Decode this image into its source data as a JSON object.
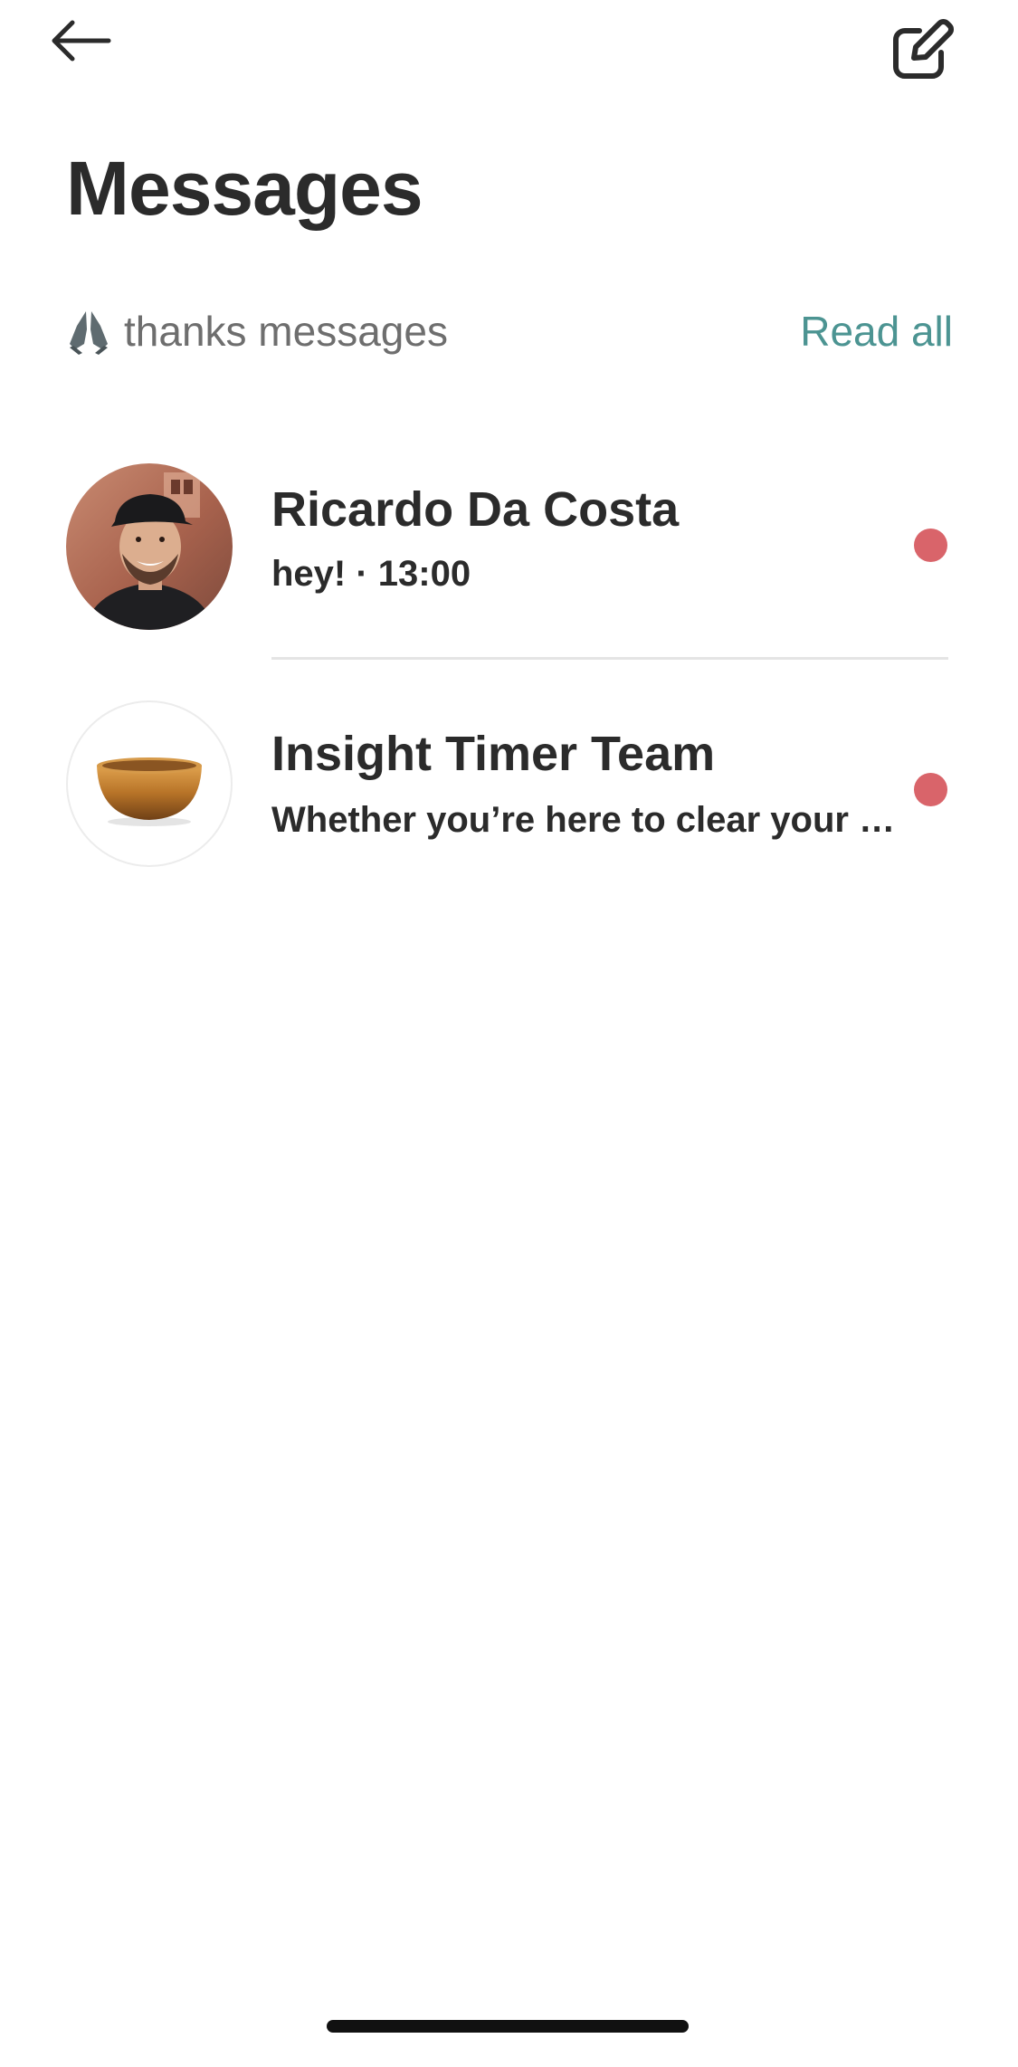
{
  "header": {
    "title": "Messages"
  },
  "filter": {
    "label": "thanks messages",
    "read_all_label": "Read all"
  },
  "conversations": [
    {
      "name": "Ricardo Da Costa",
      "preview": "hey! · 13:00",
      "unread": true
    },
    {
      "name": "Insight Timer Team",
      "preview": "Whether you’re here to clear your mi...",
      "unread": true
    }
  ],
  "icons": {
    "back": "arrow-left-icon",
    "compose": "compose-icon",
    "filter": "praying-hands-icon"
  },
  "colors": {
    "accent": "#4c9492",
    "unread_dot": "#d9646a",
    "text": "#2b2b2b",
    "muted": "#6e6e6e"
  }
}
